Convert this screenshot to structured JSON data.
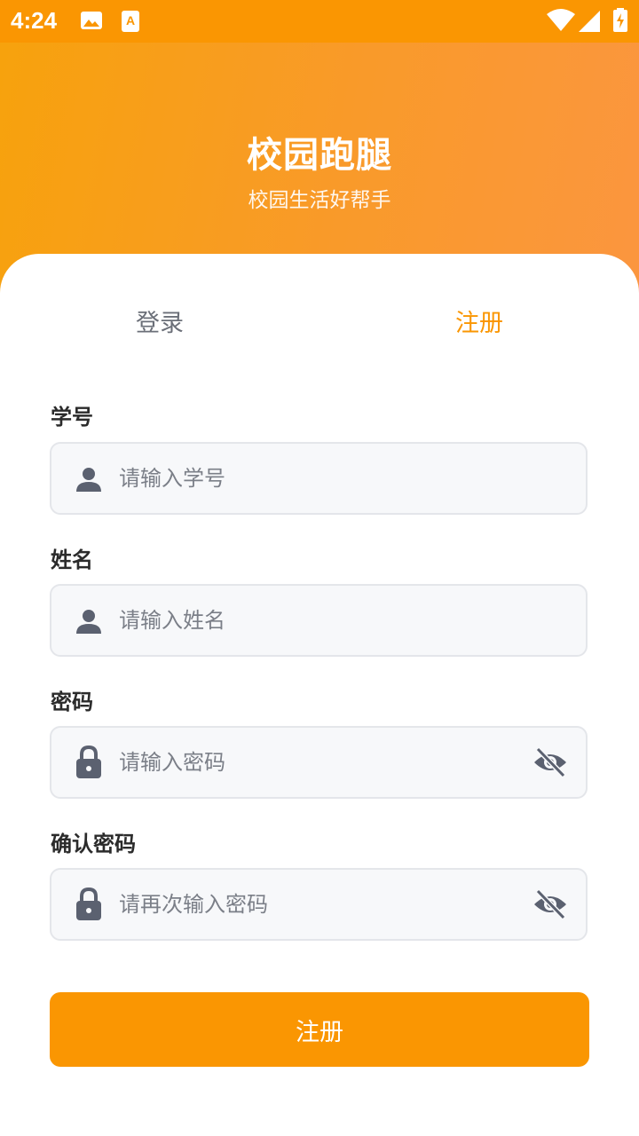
{
  "status_bar": {
    "time": "4:24",
    "icons": [
      "image-icon",
      "a-box-icon",
      "wifi-icon",
      "signal-icon",
      "battery-charging-icon"
    ]
  },
  "header": {
    "title": "校园跑腿",
    "subtitle": "校园生活好帮手"
  },
  "tabs": {
    "login": "登录",
    "register": "注册",
    "active": "register"
  },
  "form": {
    "student_id": {
      "label": "学号",
      "placeholder": "请输入学号",
      "icon": "person-icon"
    },
    "name": {
      "label": "姓名",
      "placeholder": "请输入姓名",
      "icon": "person-icon"
    },
    "password": {
      "label": "密码",
      "placeholder": "请输入密码",
      "icon": "lock-icon"
    },
    "confirm_password": {
      "label": "确认密码",
      "placeholder": "请再次输入密码",
      "icon": "lock-icon"
    },
    "submit_label": "注册"
  },
  "colors": {
    "accent": "#fa9602",
    "header_gradient_start": "#f7a20c",
    "header_gradient_end": "#fb963f",
    "inactive_tab": "#6b6f78",
    "field_bg": "#f7f8fa",
    "icon": "#5b6170"
  }
}
